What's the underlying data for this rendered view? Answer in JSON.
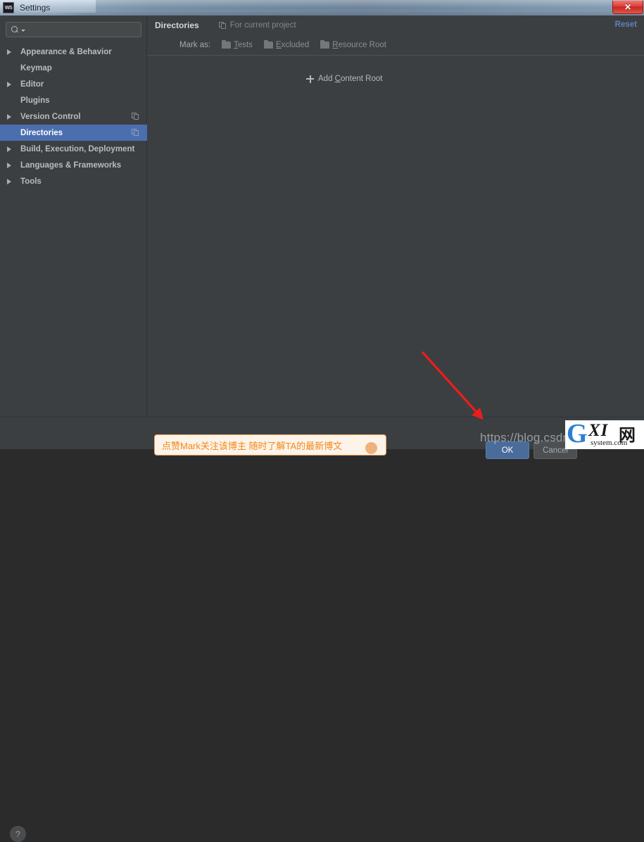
{
  "window": {
    "title": "Settings",
    "app_icon": "webstorm-icon",
    "close_label": "✕"
  },
  "sidebar": {
    "search": {
      "value": "",
      "placeholder": "",
      "icon": "search-icon"
    },
    "items": [
      {
        "label": "Appearance & Behavior",
        "expandable": true,
        "selected": false,
        "badge": false
      },
      {
        "label": "Keymap",
        "expandable": false,
        "selected": false,
        "badge": false
      },
      {
        "label": "Editor",
        "expandable": true,
        "selected": false,
        "badge": false
      },
      {
        "label": "Plugins",
        "expandable": false,
        "selected": false,
        "badge": false
      },
      {
        "label": "Version Control",
        "expandable": true,
        "selected": false,
        "badge": true
      },
      {
        "label": "Directories",
        "expandable": false,
        "selected": true,
        "badge": true
      },
      {
        "label": "Build, Execution, Deployment",
        "expandable": true,
        "selected": false,
        "badge": false
      },
      {
        "label": "Languages & Frameworks",
        "expandable": true,
        "selected": false,
        "badge": false
      },
      {
        "label": "Tools",
        "expandable": true,
        "selected": false,
        "badge": false
      }
    ],
    "help_label": "?"
  },
  "content": {
    "title": "Directories",
    "scope_label": "For current project",
    "scope_icon": "project-scope-icon",
    "reset_label": "Reset",
    "mark_as_label": "Mark as:",
    "mark_buttons": [
      {
        "mnemonic": "T",
        "rest": "ests",
        "enabled": false
      },
      {
        "mnemonic": "E",
        "rest": "xcluded",
        "enabled": false
      },
      {
        "mnemonic": "R",
        "rest": "esource Root",
        "enabled": false
      }
    ],
    "add_content_root": {
      "mnemonic_prefix": "Add ",
      "mnemonic": "C",
      "rest": "ontent Root"
    }
  },
  "footer": {
    "ok_label": "OK",
    "cancel_label": "Cancel"
  },
  "overlays": {
    "csdn_watermark": "https://blog.csdn.net",
    "gxi_logo": {
      "g": "G",
      "xi": "XI",
      "cn": "网",
      "domain": "system.com"
    },
    "promo_toast": "点赞Mark关注该博主 随时了解TA的最新博文"
  },
  "colors": {
    "accent_blue": "#4b6eaf",
    "link_blue": "#5d82c0",
    "panel_bg": "#3c3f41",
    "arrow_red": "#ee1c1c",
    "promo_orange": "#f08a1e"
  }
}
